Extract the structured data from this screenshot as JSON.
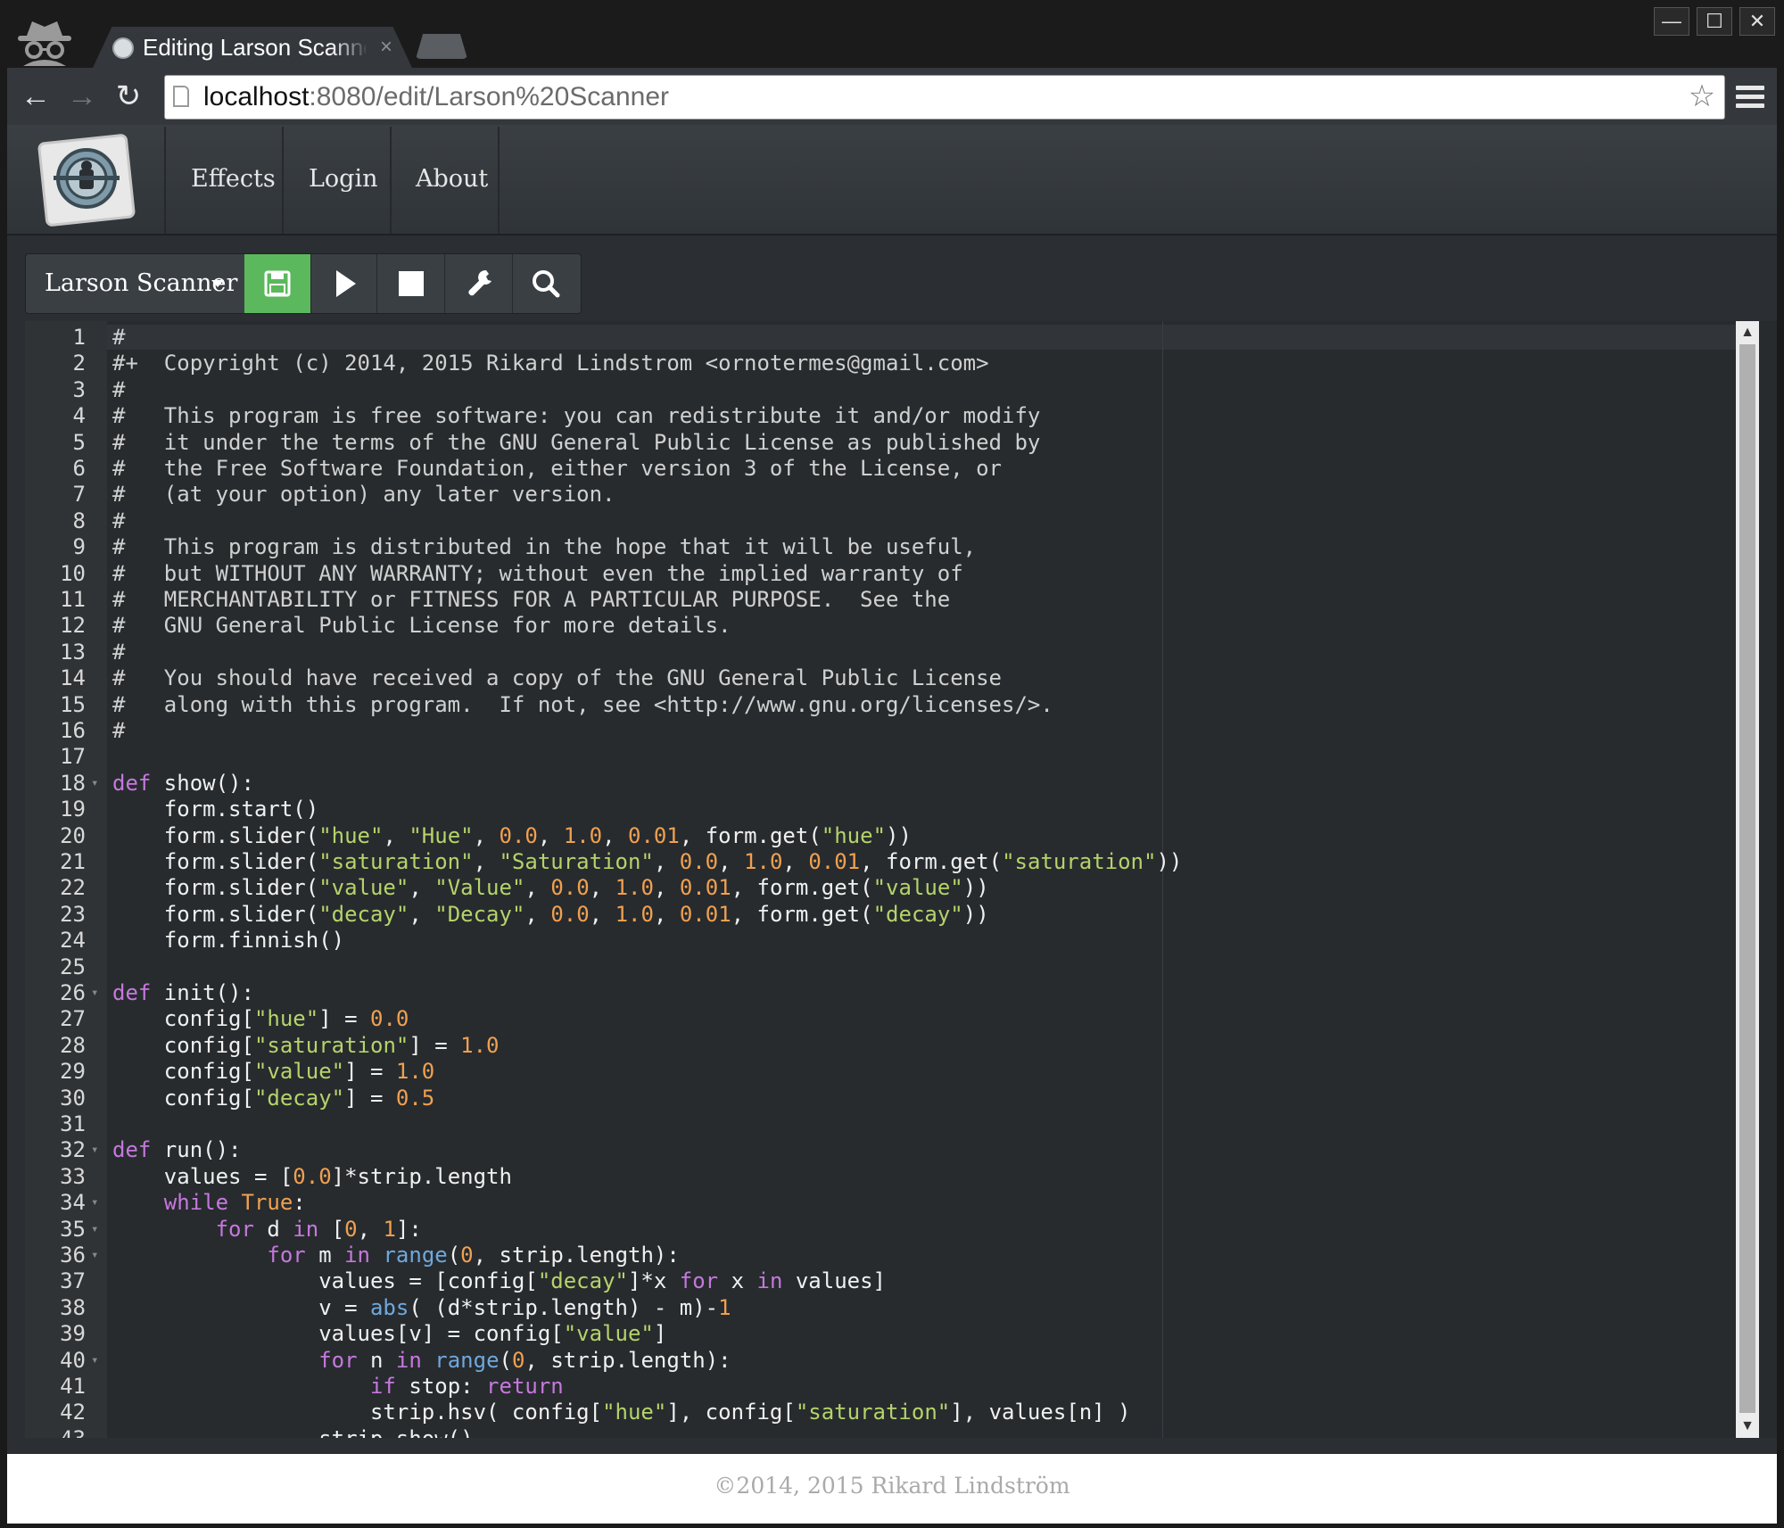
{
  "browser": {
    "tab_title": "Editing Larson Scanner",
    "tab_close": "×",
    "url_host": "localhost",
    "url_rest": ":8080/edit/Larson%20Scanner",
    "window_controls": {
      "minimize": "—",
      "maximize": "☐",
      "close": "✕"
    },
    "nav_icons": {
      "back": "←",
      "forward": "→",
      "reload": "↻",
      "bookmark": "☆"
    }
  },
  "navbar": {
    "links": [
      "Effects",
      "Login",
      "About"
    ]
  },
  "editor_toolbar": {
    "effect_name": "Larson Scanner",
    "buttons": [
      "save-icon",
      "play-icon",
      "stop-icon",
      "wrench-icon",
      "search-icon"
    ],
    "save_color": "#5cb85c"
  },
  "code_lines": [
    [
      [
        "comment",
        "#"
      ]
    ],
    [
      [
        "comment",
        "#+  Copyright (c) 2014, 2015 Rikard Lindstrom <ornotermes@gmail.com>"
      ]
    ],
    [
      [
        "comment",
        "#"
      ]
    ],
    [
      [
        "comment",
        "#   This program is free software: you can redistribute it and/or modify"
      ]
    ],
    [
      [
        "comment",
        "#   it under the terms of the GNU General Public License as published by"
      ]
    ],
    [
      [
        "comment",
        "#   the Free Software Foundation, either version 3 of the License, or"
      ]
    ],
    [
      [
        "comment",
        "#   (at your option) any later version."
      ]
    ],
    [
      [
        "comment",
        "#"
      ]
    ],
    [
      [
        "comment",
        "#   This program is distributed in the hope that it will be useful,"
      ]
    ],
    [
      [
        "comment",
        "#   but WITHOUT ANY WARRANTY; without even the implied warranty of"
      ]
    ],
    [
      [
        "comment",
        "#   MERCHANTABILITY or FITNESS FOR A PARTICULAR PURPOSE.  See the"
      ]
    ],
    [
      [
        "comment",
        "#   GNU General Public License for more details."
      ]
    ],
    [
      [
        "comment",
        "#"
      ]
    ],
    [
      [
        "comment",
        "#   You should have received a copy of the GNU General Public License"
      ]
    ],
    [
      [
        "comment",
        "#   along with this program.  If not, see <http://www.gnu.org/licenses/>."
      ]
    ],
    [
      [
        "comment",
        "#"
      ]
    ],
    [],
    [
      [
        "keyword",
        "def"
      ],
      [
        "plain",
        " show():"
      ]
    ],
    [
      [
        "plain",
        "    form.start()"
      ]
    ],
    [
      [
        "plain",
        "    form.slider("
      ],
      [
        "string",
        "\"hue\""
      ],
      [
        "plain",
        ", "
      ],
      [
        "string",
        "\"Hue\""
      ],
      [
        "plain",
        ", "
      ],
      [
        "number",
        "0.0"
      ],
      [
        "plain",
        ", "
      ],
      [
        "number",
        "1.0"
      ],
      [
        "plain",
        ", "
      ],
      [
        "number",
        "0.01"
      ],
      [
        "plain",
        ", form.get("
      ],
      [
        "string",
        "\"hue\""
      ],
      [
        "plain",
        "))"
      ]
    ],
    [
      [
        "plain",
        "    form.slider("
      ],
      [
        "string",
        "\"saturation\""
      ],
      [
        "plain",
        ", "
      ],
      [
        "string",
        "\"Saturation\""
      ],
      [
        "plain",
        ", "
      ],
      [
        "number",
        "0.0"
      ],
      [
        "plain",
        ", "
      ],
      [
        "number",
        "1.0"
      ],
      [
        "plain",
        ", "
      ],
      [
        "number",
        "0.01"
      ],
      [
        "plain",
        ", form.get("
      ],
      [
        "string",
        "\"saturation\""
      ],
      [
        "plain",
        "))"
      ]
    ],
    [
      [
        "plain",
        "    form.slider("
      ],
      [
        "string",
        "\"value\""
      ],
      [
        "plain",
        ", "
      ],
      [
        "string",
        "\"Value\""
      ],
      [
        "plain",
        ", "
      ],
      [
        "number",
        "0.0"
      ],
      [
        "plain",
        ", "
      ],
      [
        "number",
        "1.0"
      ],
      [
        "plain",
        ", "
      ],
      [
        "number",
        "0.01"
      ],
      [
        "plain",
        ", form.get("
      ],
      [
        "string",
        "\"value\""
      ],
      [
        "plain",
        "))"
      ]
    ],
    [
      [
        "plain",
        "    form.slider("
      ],
      [
        "string",
        "\"decay\""
      ],
      [
        "plain",
        ", "
      ],
      [
        "string",
        "\"Decay\""
      ],
      [
        "plain",
        ", "
      ],
      [
        "number",
        "0.0"
      ],
      [
        "plain",
        ", "
      ],
      [
        "number",
        "1.0"
      ],
      [
        "plain",
        ", "
      ],
      [
        "number",
        "0.01"
      ],
      [
        "plain",
        ", form.get("
      ],
      [
        "string",
        "\"decay\""
      ],
      [
        "plain",
        "))"
      ]
    ],
    [
      [
        "plain",
        "    form.finnish()"
      ]
    ],
    [],
    [
      [
        "keyword",
        "def"
      ],
      [
        "plain",
        " init():"
      ]
    ],
    [
      [
        "plain",
        "    config["
      ],
      [
        "string",
        "\"hue\""
      ],
      [
        "plain",
        "] = "
      ],
      [
        "number",
        "0.0"
      ]
    ],
    [
      [
        "plain",
        "    config["
      ],
      [
        "string",
        "\"saturation\""
      ],
      [
        "plain",
        "] = "
      ],
      [
        "number",
        "1.0"
      ]
    ],
    [
      [
        "plain",
        "    config["
      ],
      [
        "string",
        "\"value\""
      ],
      [
        "plain",
        "] = "
      ],
      [
        "number",
        "1.0"
      ]
    ],
    [
      [
        "plain",
        "    config["
      ],
      [
        "string",
        "\"decay\""
      ],
      [
        "plain",
        "] = "
      ],
      [
        "number",
        "0.5"
      ]
    ],
    [],
    [
      [
        "keyword",
        "def"
      ],
      [
        "plain",
        " run():"
      ]
    ],
    [
      [
        "plain",
        "    values = ["
      ],
      [
        "number",
        "0.0"
      ],
      [
        "plain",
        "]*strip.length"
      ]
    ],
    [
      [
        "plain",
        "    "
      ],
      [
        "keyword",
        "while"
      ],
      [
        "plain",
        " "
      ],
      [
        "number",
        "True"
      ],
      [
        "plain",
        ":"
      ]
    ],
    [
      [
        "plain",
        "        "
      ],
      [
        "keyword",
        "for"
      ],
      [
        "plain",
        " d "
      ],
      [
        "keyword",
        "in"
      ],
      [
        "plain",
        " ["
      ],
      [
        "number",
        "0"
      ],
      [
        "plain",
        ", "
      ],
      [
        "number",
        "1"
      ],
      [
        "plain",
        "]:"
      ]
    ],
    [
      [
        "plain",
        "            "
      ],
      [
        "keyword",
        "for"
      ],
      [
        "plain",
        " m "
      ],
      [
        "keyword",
        "in"
      ],
      [
        "plain",
        " "
      ],
      [
        "builtin",
        "range"
      ],
      [
        "plain",
        "("
      ],
      [
        "number",
        "0"
      ],
      [
        "plain",
        ", strip.length):"
      ]
    ],
    [
      [
        "plain",
        "                values = [config["
      ],
      [
        "string",
        "\"decay\""
      ],
      [
        "plain",
        "]*x "
      ],
      [
        "keyword",
        "for"
      ],
      [
        "plain",
        " x "
      ],
      [
        "keyword",
        "in"
      ],
      [
        "plain",
        " values]"
      ]
    ],
    [
      [
        "plain",
        "                v = "
      ],
      [
        "builtin",
        "abs"
      ],
      [
        "plain",
        "( (d*strip.length) - m)-"
      ],
      [
        "number",
        "1"
      ]
    ],
    [
      [
        "plain",
        "                values[v] = config["
      ],
      [
        "string",
        "\"value\""
      ],
      [
        "plain",
        "]"
      ]
    ],
    [
      [
        "plain",
        "                "
      ],
      [
        "keyword",
        "for"
      ],
      [
        "plain",
        " n "
      ],
      [
        "keyword",
        "in"
      ],
      [
        "plain",
        " "
      ],
      [
        "builtin",
        "range"
      ],
      [
        "plain",
        "("
      ],
      [
        "number",
        "0"
      ],
      [
        "plain",
        ", strip.length):"
      ]
    ],
    [
      [
        "plain",
        "                    "
      ],
      [
        "keyword",
        "if"
      ],
      [
        "plain",
        " stop: "
      ],
      [
        "keyword",
        "return"
      ]
    ],
    [
      [
        "plain",
        "                    strip.hsv( config["
      ],
      [
        "string",
        "\"hue\""
      ],
      [
        "plain",
        "], config["
      ],
      [
        "string",
        "\"saturation\""
      ],
      [
        "plain",
        "], values[n] )"
      ]
    ],
    [
      [
        "plain",
        "                strip.show()"
      ]
    ]
  ],
  "fold_markers": [
    18,
    26,
    32,
    34,
    35,
    36,
    40
  ],
  "footer": {
    "text": "©2014, 2015 Rikard Lindström"
  }
}
